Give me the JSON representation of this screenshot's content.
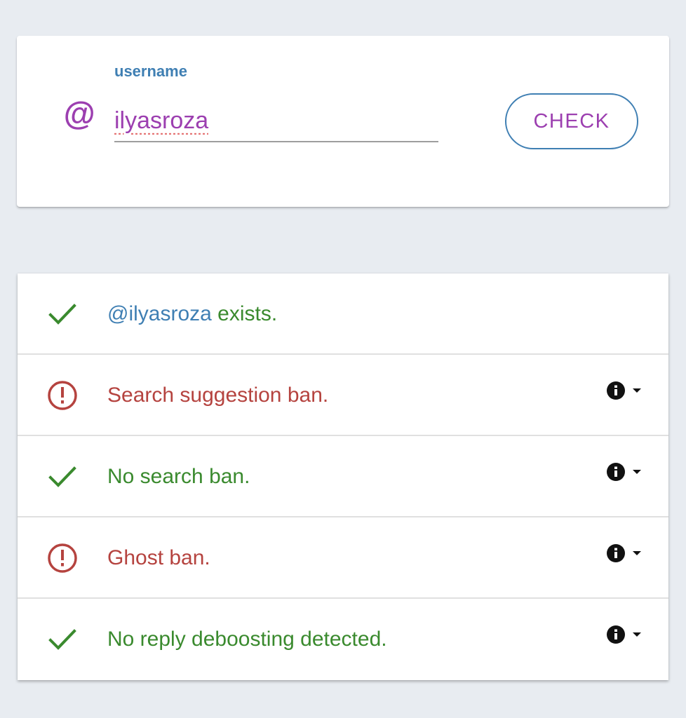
{
  "colors": {
    "purple": "#9c3fb0",
    "blue": "#3f7fb3",
    "green": "#3a8a2e",
    "red": "#b5433f",
    "black": "#111111"
  },
  "search": {
    "at_symbol": "@",
    "label": "username",
    "value": "ilyasroza",
    "placeholder": "",
    "button_label": "CHECK"
  },
  "results": [
    {
      "status": "pass",
      "icon": "check-icon",
      "handle": "@ilyasroza",
      "text": " exists.",
      "has_details": false
    },
    {
      "status": "fail",
      "icon": "alert-circle-icon",
      "text": "Search suggestion ban.",
      "has_details": true
    },
    {
      "status": "pass",
      "icon": "check-icon",
      "text": "No search ban.",
      "has_details": true
    },
    {
      "status": "fail",
      "icon": "alert-circle-icon",
      "text": "Ghost ban.",
      "has_details": true
    },
    {
      "status": "pass",
      "icon": "check-icon",
      "text": "No reply deboosting detected.",
      "has_details": true
    }
  ]
}
